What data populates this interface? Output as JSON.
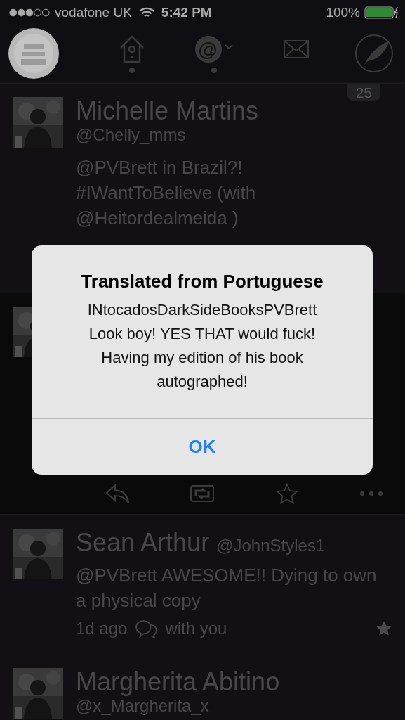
{
  "status_bar": {
    "carrier": "vodafone UK",
    "time": "5:42 PM",
    "battery": "100%"
  },
  "nav": {
    "tabs": [
      {
        "kind": "home",
        "selected": false,
        "unread": true
      },
      {
        "kind": "mentions",
        "selected": true,
        "unread": true
      },
      {
        "kind": "messages",
        "selected": false,
        "unread": false
      }
    ]
  },
  "unread_count": "25",
  "tweets": [
    {
      "kind": "stacked",
      "name": "Michelle Martins",
      "handle": "@Chelly_mms",
      "text": "@PVBrett in Brazil?! #IWantToBelieve (with @Heitordealmeida )",
      "selected": false
    },
    {
      "kind": "hidden",
      "selected": true
    },
    {
      "kind": "inline",
      "name": "Sean Arthur",
      "handle": "@JohnStyles1",
      "text": "@PVBrett AWESOME!!  Dying to own a physical copy",
      "time": "1d ago",
      "context": "with you",
      "starred": true,
      "selected": false
    },
    {
      "kind": "stacked",
      "name": "Margherita Abitino",
      "handle": "@x_Margherita_x",
      "selected": false
    }
  ],
  "dialog": {
    "title": "Translated from Portuguese",
    "message": "INtocadosDarkSideBooksPVBrett Look boy! YES THAT would fuck! Having my edition of his book autographed!",
    "button": "OK"
  }
}
